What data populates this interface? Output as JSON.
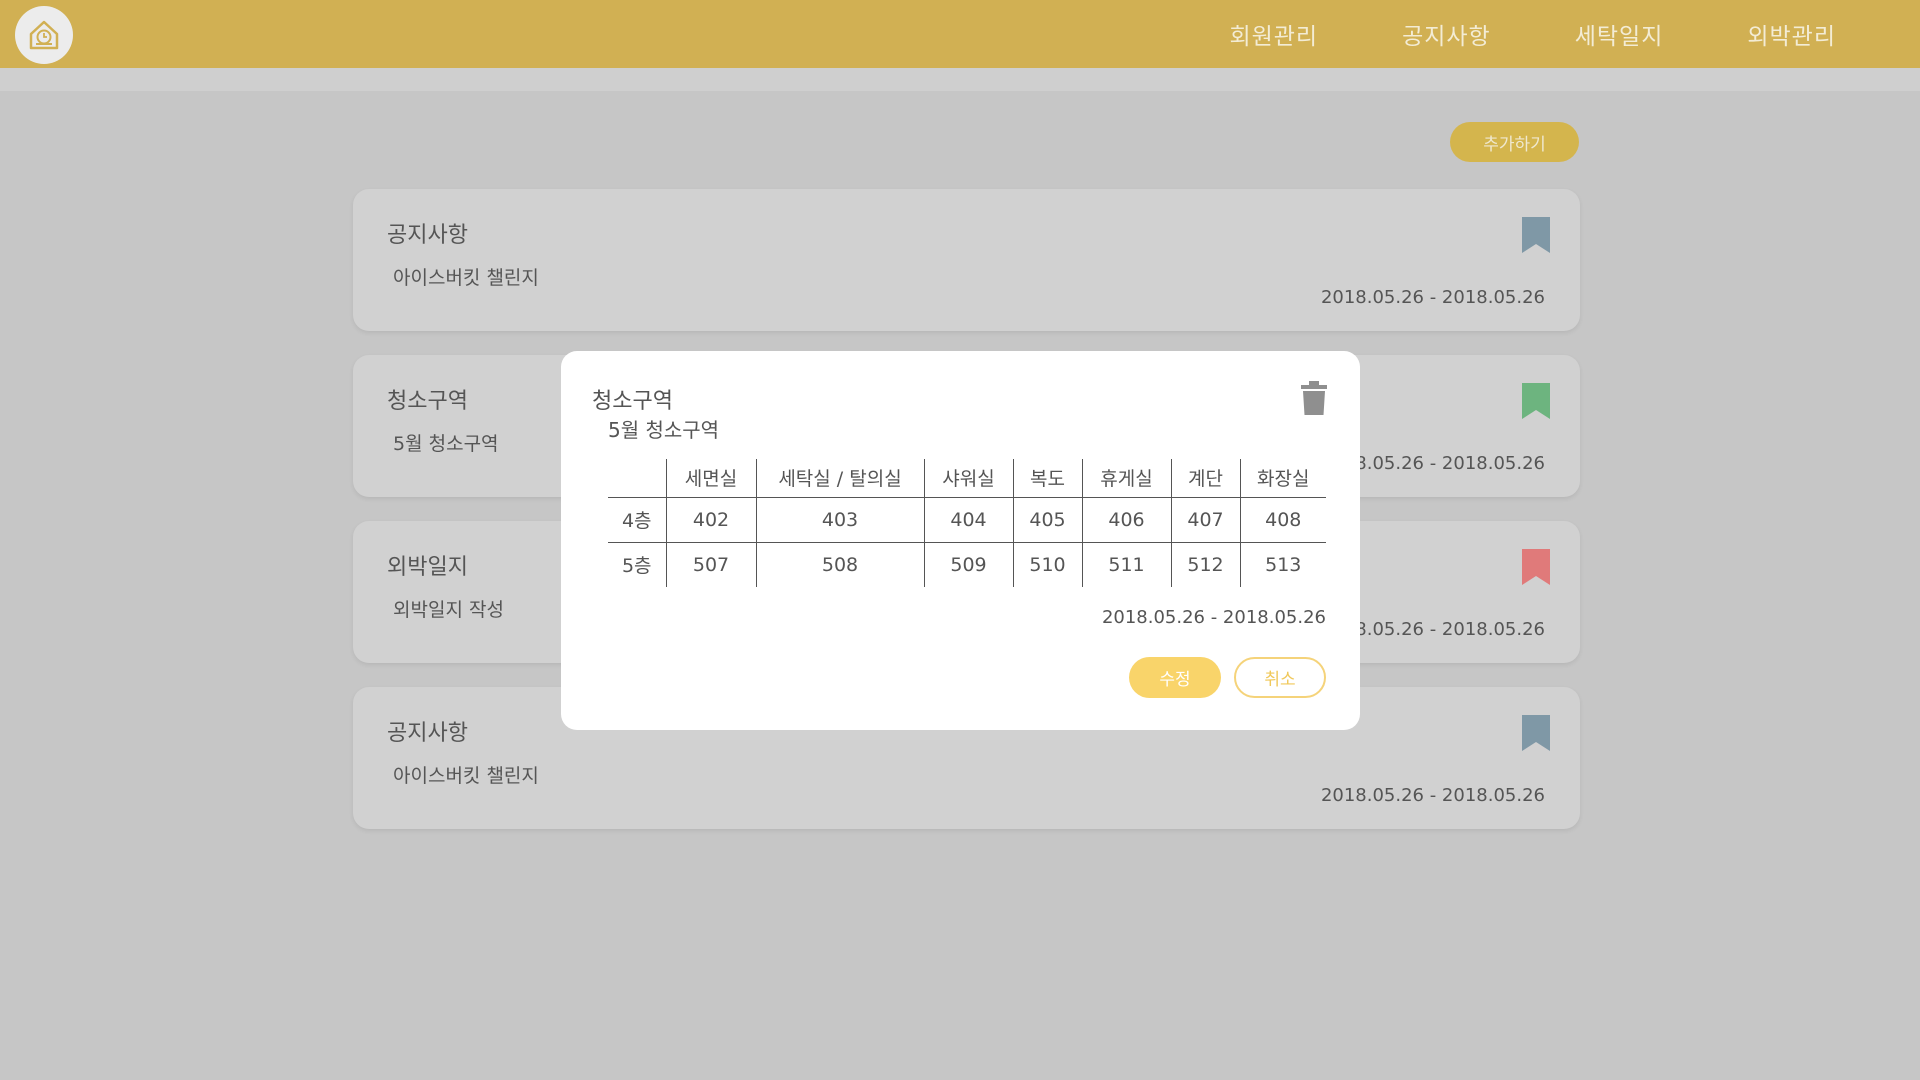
{
  "header": {
    "logo_icon": "house-clock-icon",
    "nav": [
      "회원관리",
      "공지사항",
      "세탁일지",
      "외박관리"
    ]
  },
  "toolbar": {
    "add_label": "추가하기"
  },
  "cards": [
    {
      "title": "공지사항",
      "subtitle": "아이스버킷 챌린지",
      "date": "2018.05.26 - 2018.05.26",
      "bookmark_color": "#7f98a6"
    },
    {
      "title": "청소구역",
      "subtitle": "5월 청소구역",
      "date": "2018.05.26 - 2018.05.26",
      "bookmark_color": "#6db47f"
    },
    {
      "title": "외박일지",
      "subtitle": "외박일지 작성",
      "date": "2018.05.26 - 2018.05.26",
      "bookmark_color": "#e07a7a"
    },
    {
      "title": "공지사항",
      "subtitle": "아이스버킷 챌린지",
      "date": "2018.05.26 - 2018.05.26",
      "bookmark_color": "#7f98a6"
    }
  ],
  "modal": {
    "title": "청소구역",
    "subtitle": "5월 청소구역",
    "delete_icon": "trash-icon",
    "table": {
      "headers": [
        "",
        "세면실",
        "세탁실 / 탈의실",
        "샤워실",
        "복도",
        "휴게실",
        "계단",
        "화장실"
      ],
      "rows": [
        [
          "4층",
          "402",
          "403",
          "404",
          "405",
          "406",
          "407",
          "408"
        ],
        [
          "5층",
          "507",
          "508",
          "509",
          "510",
          "511",
          "512",
          "513"
        ]
      ]
    },
    "date": "2018.05.26 - 2018.05.26",
    "edit_label": "수정",
    "cancel_label": "취소"
  }
}
